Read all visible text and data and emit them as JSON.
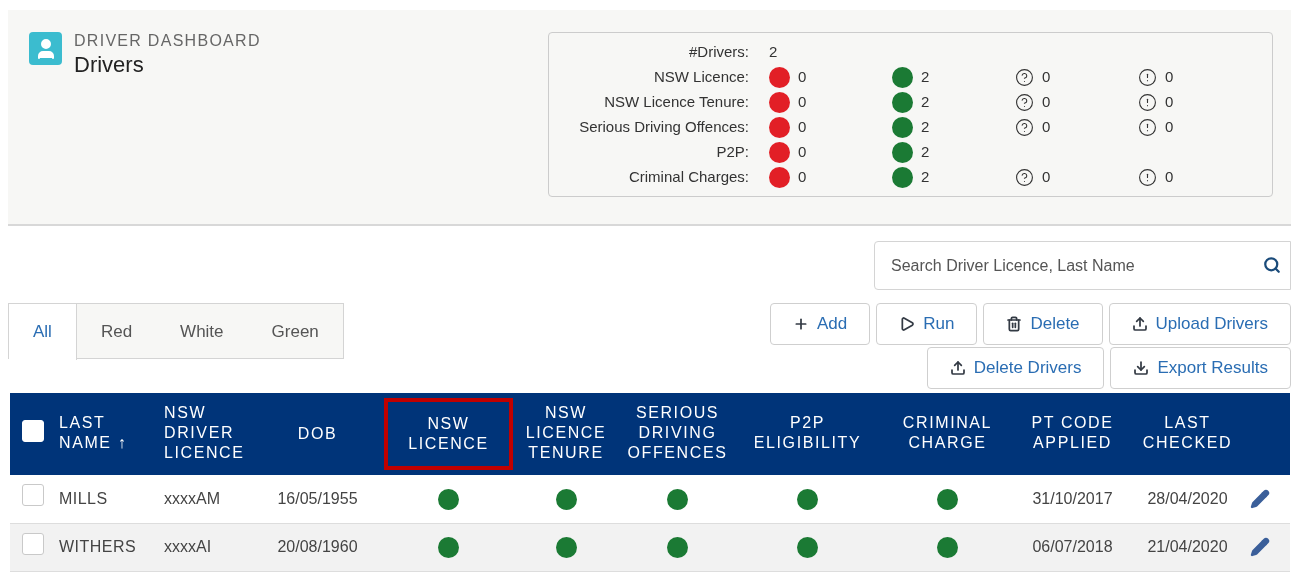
{
  "header": {
    "eyebrow": "DRIVER DASHBOARD",
    "title": "Drivers"
  },
  "summary": {
    "count_label": "#Drivers:",
    "count": "2",
    "rows": [
      {
        "label": "NSW Licence:",
        "red": "0",
        "green": "2",
        "unknown": "0",
        "alert": "0"
      },
      {
        "label": "NSW Licence Tenure:",
        "red": "0",
        "green": "2",
        "unknown": "0",
        "alert": "0"
      },
      {
        "label": "Serious Driving Offences:",
        "red": "0",
        "green": "2",
        "unknown": "0",
        "alert": "0"
      },
      {
        "label": "P2P:",
        "red": "0",
        "green": "2"
      },
      {
        "label": "Criminal Charges:",
        "red": "0",
        "green": "2",
        "unknown": "0",
        "alert": "0"
      }
    ]
  },
  "search": {
    "placeholder": "Search Driver Licence, Last Name"
  },
  "tabs": [
    {
      "label": "All",
      "selected": true
    },
    {
      "label": "Red",
      "selected": false
    },
    {
      "label": "White",
      "selected": false
    },
    {
      "label": "Green",
      "selected": false
    }
  ],
  "actions": [
    [
      {
        "label": "Add",
        "kind": "add"
      },
      {
        "label": "Run",
        "kind": "run"
      },
      {
        "label": "Delete",
        "kind": "delete"
      },
      {
        "label": "Upload Drivers",
        "kind": "upload"
      }
    ],
    [
      {
        "label": "Delete Drivers",
        "kind": "upload"
      },
      {
        "label": "Export Results",
        "kind": "download"
      }
    ]
  ],
  "table": {
    "select_all": {
      "checked": false
    },
    "columns": [
      {
        "label": "LAST NAME ↑",
        "highlighted": false
      },
      {
        "label": "NSW DRIVER LICENCE",
        "highlighted": false
      },
      {
        "label": "DOB",
        "highlighted": false
      },
      {
        "label": "NSW LICENCE",
        "highlighted": true
      },
      {
        "label": "NSW LICENCE TENURE",
        "highlighted": false
      },
      {
        "label": "SERIOUS DRIVING OFFENCES",
        "highlighted": false
      },
      {
        "label": "P2P ELIGIBILITY",
        "highlighted": false
      },
      {
        "label": "CRIMINAL CHARGE",
        "highlighted": false
      },
      {
        "label": "PT CODE APPLIED",
        "highlighted": false
      },
      {
        "label": "LAST CHECKED",
        "highlighted": false
      }
    ],
    "rows": [
      {
        "checked": false,
        "last_name": "MILLS",
        "licence": "xxxxAM",
        "dob": "16/05/1955",
        "statuses": [
          {
            "color": "#1b7a34"
          },
          {
            "color": "#1b7a34"
          },
          {
            "color": "#1b7a34"
          },
          {
            "color": "#1b7a34"
          },
          {
            "color": "#1b7a34"
          }
        ],
        "pt_code_applied": "31/10/2017",
        "last_checked": "28/04/2020"
      },
      {
        "checked": false,
        "last_name": "WITHERS",
        "licence": "xxxxAI",
        "dob": "20/08/1960",
        "statuses": [
          {
            "color": "#1b7a34"
          },
          {
            "color": "#1b7a34"
          },
          {
            "color": "#1b7a34"
          },
          {
            "color": "#1b7a34"
          },
          {
            "color": "#1b7a34"
          }
        ],
        "pt_code_applied": "06/07/2018",
        "last_checked": "21/04/2020"
      }
    ]
  }
}
